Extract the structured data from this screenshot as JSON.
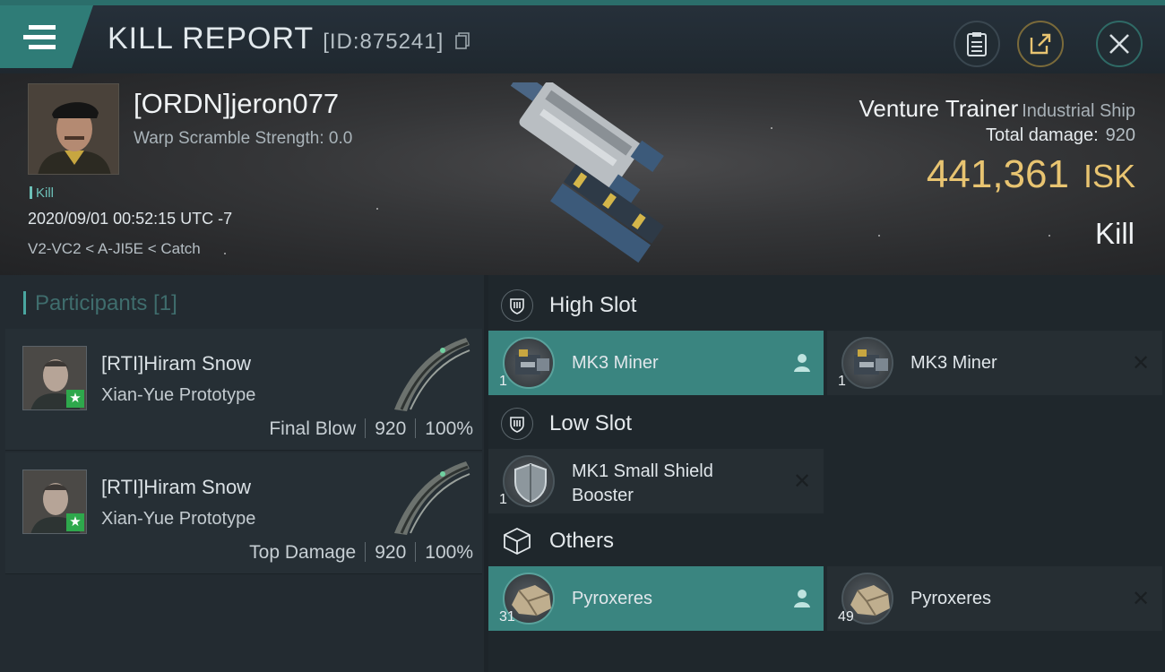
{
  "header": {
    "title": "KILL REPORT",
    "report_id": "[ID:875241]"
  },
  "victim": {
    "name": "[ORDN]jeron077",
    "warp_scramble": "Warp Scramble Strength: 0.0",
    "kill_tag": "Kill",
    "datetime": "2020/09/01 00:52:15 UTC -7",
    "route": "V2-VC2 < A-JI5E < Catch"
  },
  "ship": {
    "name": "Venture Trainer",
    "class": "Industrial Ship",
    "total_damage_label": "Total damage:",
    "total_damage_value": "920",
    "isk_value": "441,361",
    "isk_unit": "ISK",
    "result": "Kill"
  },
  "participants": {
    "header": "Participants [1]",
    "rows": [
      {
        "name": "[RTI]Hiram Snow",
        "ship": "Xian-Yue Prototype",
        "role": "Final Blow",
        "damage": "920",
        "percent": "100%"
      },
      {
        "name": "[RTI]Hiram Snow",
        "ship": "Xian-Yue Prototype",
        "role": "Top Damage",
        "damage": "920",
        "percent": "100%"
      }
    ]
  },
  "fitting": {
    "high_slot": {
      "label": "High Slot",
      "items": [
        {
          "name": "MK3 Miner",
          "qty": "1",
          "state": "dropped"
        },
        {
          "name": "MK3 Miner",
          "qty": "1",
          "state": "destroyed"
        }
      ]
    },
    "low_slot": {
      "label": "Low Slot",
      "items": [
        {
          "name_line1": "MK1 Small Shield",
          "name_line2": "Booster",
          "qty": "1",
          "state": "destroyed"
        }
      ]
    },
    "others": {
      "label": "Others",
      "items": [
        {
          "name": "Pyroxeres",
          "qty": "31",
          "state": "dropped"
        },
        {
          "name": "Pyroxeres",
          "qty": "49",
          "state": "destroyed"
        }
      ]
    }
  },
  "colors": {
    "accent_teal": "#3a8580",
    "isk_gold": "#e8c471",
    "bg_dark": "#1d2429"
  }
}
